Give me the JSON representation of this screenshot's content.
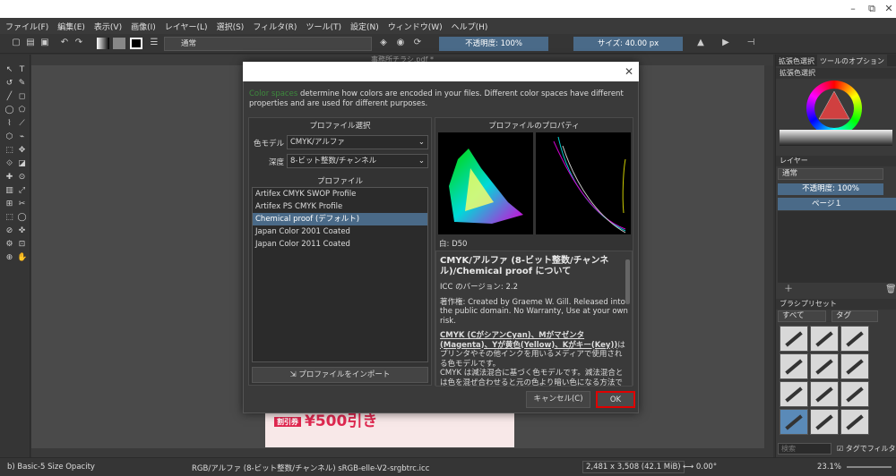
{
  "window": {
    "minimize": "–",
    "restore": "⧉",
    "close": "✕"
  },
  "menu": [
    "ファイル(F)",
    "編集(E)",
    "表示(V)",
    "画像(I)",
    "レイヤー(L)",
    "選択(S)",
    "フィルタ(R)",
    "ツール(T)",
    "設定(N)",
    "ウィンドウ(W)",
    "ヘルプ(H)"
  ],
  "toolbar": {
    "blend_mode": "通常",
    "opacity": "不透明度: 100%",
    "size": "サイズ: 40.00 px"
  },
  "document": {
    "tab_title": "事務所チラシ.pdf *",
    "promo_badge": "割引券",
    "promo_text": "¥500引き"
  },
  "right_panel": {
    "tabs": [
      "拡張色選択",
      "ツールのオプション"
    ],
    "color_header": "拡張色選択",
    "layers_header": "レイヤー",
    "layer_blend": "通常",
    "layer_opacity": "不透明度: 100%",
    "layer_name": "ページ１",
    "brush_header": "ブラシプリセット",
    "brush_filter": "すべて",
    "brush_tag": "タグ",
    "search_placeholder": "検索",
    "tag_filter": "タグでフィルタ"
  },
  "dialog": {
    "close": "✕",
    "desc_link": "Color spaces",
    "desc": " determine how colors are encoded in your files. Different color spaces have different properties and are used for different purposes.",
    "profile_select_title": "プロファイル選択",
    "color_model_label": "色モデル",
    "color_model_value": "CMYK/アルファ",
    "depth_label": "深度",
    "depth_value": "8-ビット整数/チャンネル",
    "profile_title": "プロファイル",
    "profiles": [
      {
        "label": "Artifex CMYK SWOP Profile",
        "selected": false
      },
      {
        "label": "Artifex PS CMYK Profile",
        "selected": false
      },
      {
        "label": "Chemical proof (デフォルト)",
        "selected": true
      },
      {
        "label": "Japan Color 2001 Coated",
        "selected": false
      },
      {
        "label": "Japan Color 2011 Coated",
        "selected": false
      }
    ],
    "import_button": "プロファイルをインポート",
    "props_title": "プロファイルのプロパティ",
    "white_point": "白: D50",
    "info_heading": "CMYK/アルファ (8-ビット整数/チャンネル)/Chemical proof について",
    "icc_version": "ICC のバージョン: 2.2",
    "copyright": "著作権: Created by Graeme W. Gill. Released into the public domain. No Warranty, Use at your own risk.",
    "cmyk_heading": "CMYK (CがシアンCyan)、Mがマゼンタ(Magenta)、Yが黄色(Yellow)、Kがキー(Key))",
    "cmyk_body1": "はプリンタやその他インクを用いるメディアで使用される色モデルです。",
    "cmyk_body2": "CMYK は減法混合に基づく色モデルです。減法混合とは色を混ぜ合わせると元の色より暗い色になる方法です。",
    "cancel": "キャンセル(C)",
    "ok": "OK"
  },
  "status": {
    "brush": "b) Basic-5 Size Opacity",
    "colorspace": "RGB/アルファ (8-ビット整数/チャンネル)  sRGB-elle-V2-srgbtrc.icc",
    "dimensions": "2,481 x 3,508 (42.1 MiB)",
    "rotation": "0.00°",
    "zoom": "23.1%"
  }
}
